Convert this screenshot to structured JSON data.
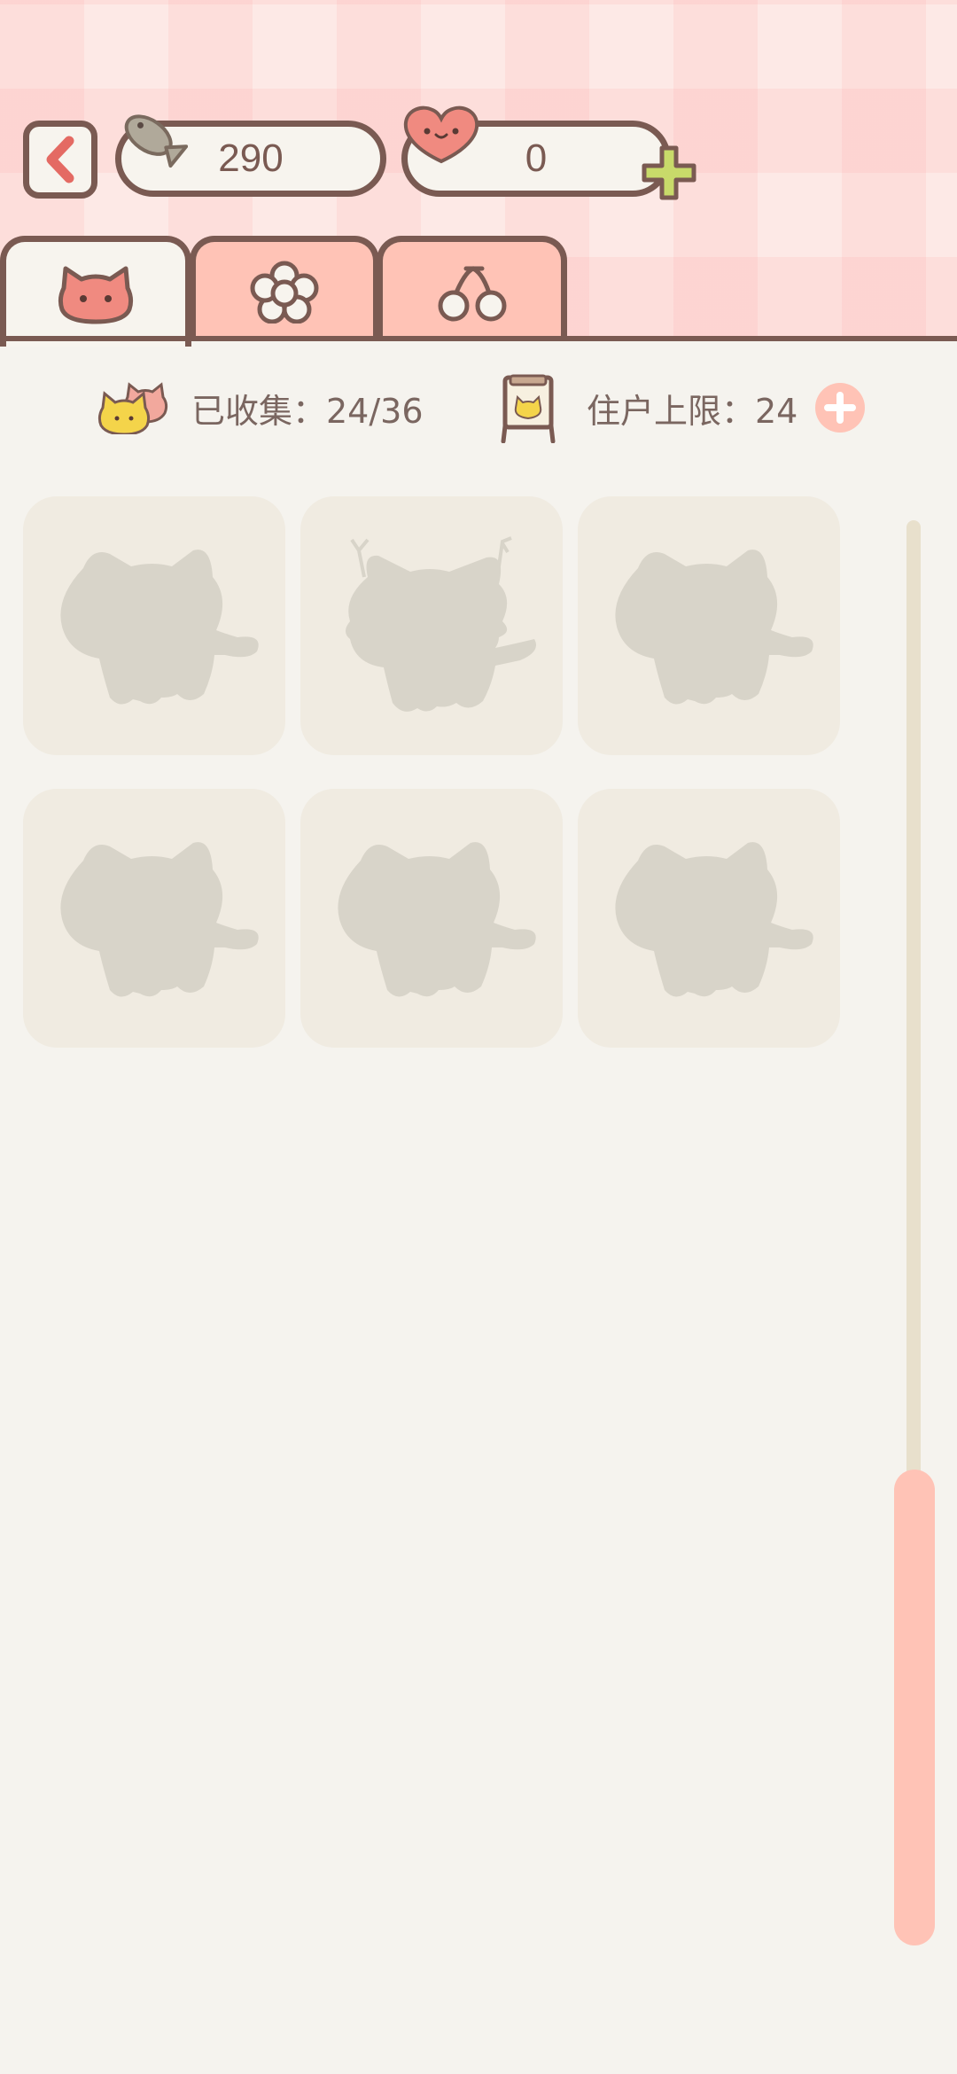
{
  "header": {
    "fish_count": "290",
    "heart_count": "0"
  },
  "tabs": [
    {
      "name": "cats",
      "icon": "cat-face-icon",
      "active": true
    },
    {
      "name": "flowers",
      "icon": "flower-icon",
      "active": false
    },
    {
      "name": "cherries",
      "icon": "cherry-icon",
      "active": false
    }
  ],
  "info": {
    "collected_label": "已收集：24/36",
    "resident_label": "住户上限：24"
  },
  "grid": {
    "cards": [
      {
        "variant": "cat-silhouette"
      },
      {
        "variant": "lynx-silhouette"
      },
      {
        "variant": "cat-silhouette"
      },
      {
        "variant": "cat-silhouette"
      },
      {
        "variant": "cat-silhouette"
      },
      {
        "variant": "cat-silhouette"
      }
    ]
  },
  "scroll": {
    "position": 0.73
  },
  "colors": {
    "outline": "#7a5a52",
    "accent_pink": "#ffc3b6",
    "background": "#f5f3ee",
    "card": "#f0ebe1",
    "silhouette": "#d8d4c9",
    "plus_green": "#c8da6a"
  }
}
